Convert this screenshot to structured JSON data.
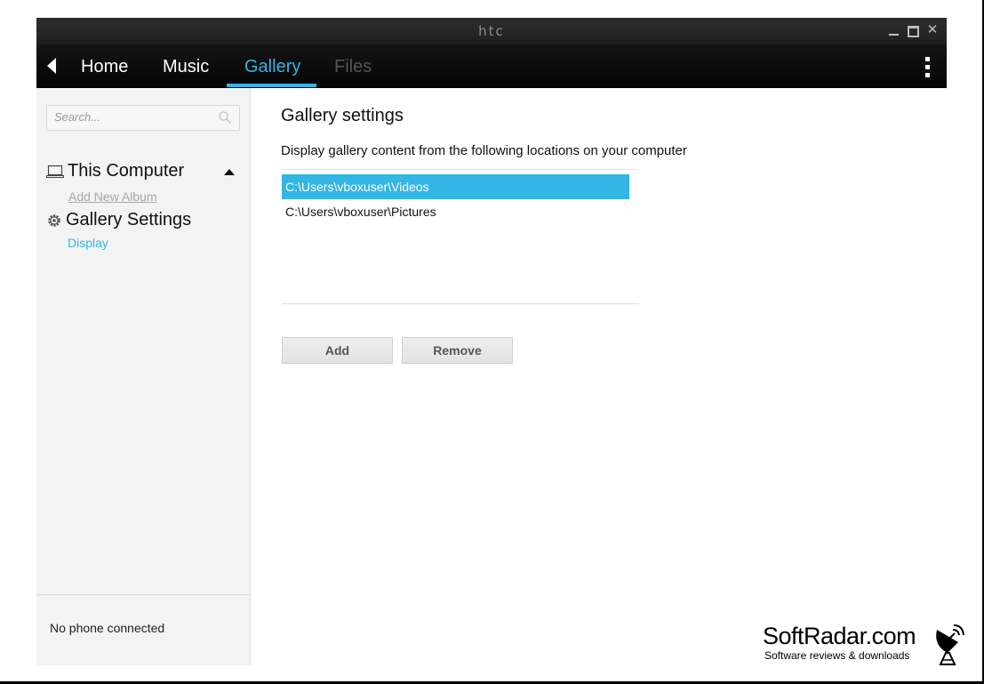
{
  "window": {
    "brand": "htc",
    "controls": {
      "minimize": "minimize",
      "maximize": "maximize",
      "close": "✕"
    }
  },
  "nav": {
    "tabs": [
      {
        "label": "Home",
        "state": "normal"
      },
      {
        "label": "Music",
        "state": "normal"
      },
      {
        "label": "Gallery",
        "state": "active"
      },
      {
        "label": "Files",
        "state": "disabled"
      }
    ]
  },
  "sidebar": {
    "search_placeholder": "Search...",
    "computer_label": "This Computer",
    "add_album": "Add New Album",
    "gallery_settings": "Gallery Settings",
    "display_link": "Display",
    "phone_status": "No phone connected"
  },
  "main": {
    "title": "Gallery settings",
    "description": "Display gallery content from the following locations on your computer",
    "locations": [
      {
        "path": "C:\\Users\\vboxuser\\Videos",
        "selected": true
      },
      {
        "path": "C:\\Users\\vboxuser\\Pictures",
        "selected": false
      }
    ],
    "add_label": "Add",
    "remove_label": "Remove"
  },
  "watermark": {
    "name": "SoftRadar.com",
    "tagline": "Software reviews & downloads"
  },
  "colors": {
    "accent": "#33b5e5",
    "navbar": "#0a0a0a",
    "titlebar": "#262626",
    "sidebar": "#f3f3f3"
  }
}
